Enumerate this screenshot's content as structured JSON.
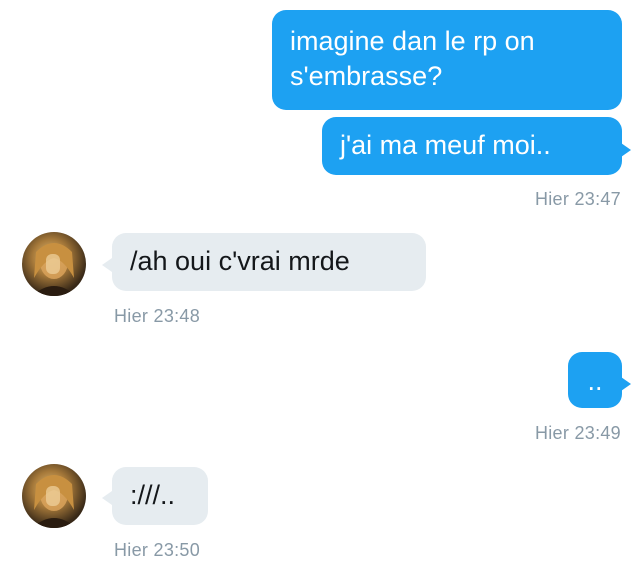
{
  "messages": [
    {
      "direction": "outgoing",
      "lines": [
        "imagine dan le rp on",
        "s'embrasse?"
      ]
    },
    {
      "direction": "outgoing",
      "text": "j'ai ma meuf moi..",
      "timestamp": "Hier 23:47"
    },
    {
      "direction": "incoming",
      "text": "/ah oui c'vrai mrde",
      "timestamp": "Hier 23:48"
    },
    {
      "direction": "outgoing",
      "text": "..",
      "timestamp": "Hier 23:49"
    },
    {
      "direction": "incoming",
      "text": ":///..",
      "timestamp": "Hier 23:50"
    }
  ],
  "colors": {
    "outgoing_bubble": "#1da1f2",
    "incoming_bubble": "#e6ecf0",
    "timestamp_text": "#8899a6"
  },
  "icons": {
    "contact_avatar": "avatar-photo"
  }
}
